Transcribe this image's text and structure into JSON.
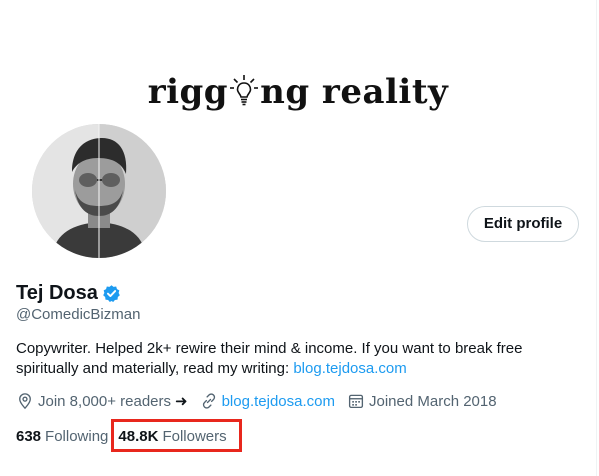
{
  "banner": {
    "title_left": "rigg",
    "title_right": "ng reality"
  },
  "profile": {
    "name": "Tej Dosa",
    "handle": "@ComedicBizman",
    "bio_text": "Copywriter. Helped 2k+ rewire their mind & income. If you want to break free spiritually and materially, read my writing: ",
    "bio_link": "blog.tejdosa.com",
    "location": "Join 8,000+ readers",
    "location_arrow": "➜",
    "website": "blog.tejdosa.com",
    "joined": "Joined March 2018",
    "following_count": "638",
    "following_label": "Following",
    "followers_count": "48.8K",
    "followers_label": "Followers"
  },
  "actions": {
    "edit_profile": "Edit profile"
  },
  "colors": {
    "link": "#1d9bf0",
    "verified": "#1d9bf0",
    "highlight": "#e8271d",
    "muted": "#536471"
  },
  "icons": [
    "lightbulb-icon",
    "verified-badge-icon",
    "location-pin-icon",
    "link-icon",
    "calendar-icon"
  ]
}
